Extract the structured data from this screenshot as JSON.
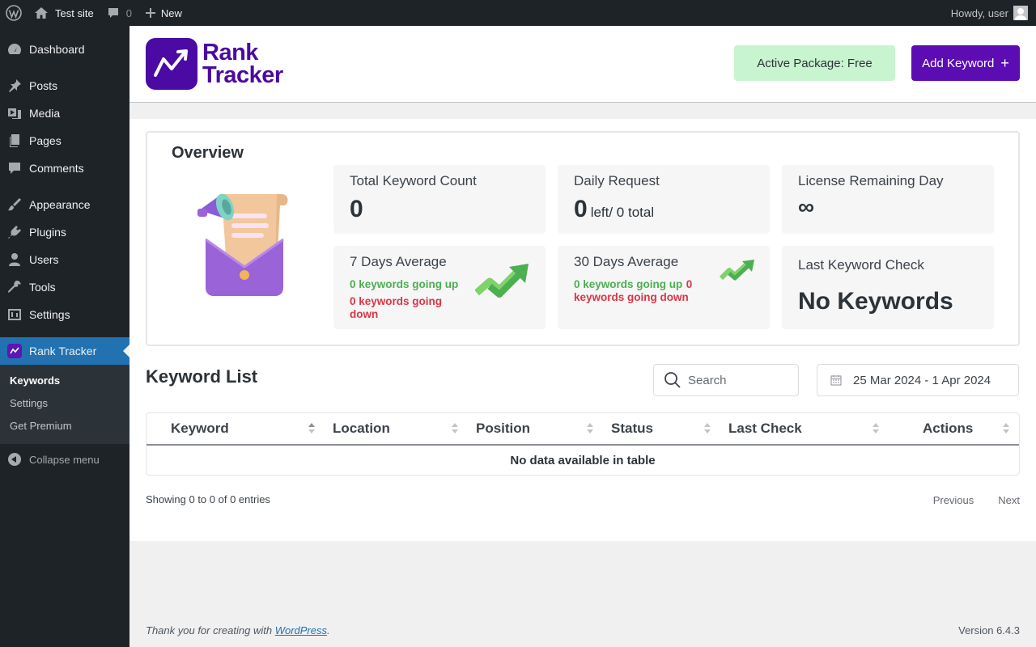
{
  "adminbar": {
    "site_name": "Test site",
    "comments_count": "0",
    "new_label": "New",
    "greeting": "Howdy, user"
  },
  "sidebar": {
    "items": [
      {
        "label": "Dashboard",
        "icon": "dashboard-icon"
      },
      {
        "label": "Posts",
        "icon": "pin-icon"
      },
      {
        "label": "Media",
        "icon": "media-icon"
      },
      {
        "label": "Pages",
        "icon": "pages-icon"
      },
      {
        "label": "Comments",
        "icon": "comment-icon"
      },
      {
        "label": "Appearance",
        "icon": "brush-icon"
      },
      {
        "label": "Plugins",
        "icon": "plug-icon"
      },
      {
        "label": "Users",
        "icon": "user-icon"
      },
      {
        "label": "Tools",
        "icon": "wrench-icon"
      },
      {
        "label": "Settings",
        "icon": "settings-icon"
      },
      {
        "label": "Rank Tracker",
        "icon": "rank-tracker-icon"
      }
    ],
    "submenu": [
      "Keywords",
      "Settings",
      "Get Premium"
    ],
    "collapse_label": "Collapse menu"
  },
  "header": {
    "logo_line1": "Rank",
    "logo_line2": "Tracker",
    "package_label": "Active Package: Free",
    "add_keyword_label": "Add Keyword",
    "add_keyword_icon": "+"
  },
  "overview": {
    "title": "Overview",
    "total_keyword": {
      "label": "Total Keyword Count",
      "value": "0"
    },
    "daily_request": {
      "label": "Daily Request",
      "value": "0",
      "suffix": "left/ 0 total"
    },
    "license": {
      "label": "License Remaining Day",
      "value": "∞"
    },
    "avg7": {
      "label": "7 Days Average",
      "up": "0 keywords going up",
      "down": "0 keywords going down"
    },
    "avg30": {
      "label": "30 Days Average",
      "up": "0 keywords going up",
      "down": "0 keywords going down"
    },
    "last_check": {
      "label": "Last Keyword Check",
      "value": "No Keywords"
    }
  },
  "keyword_list": {
    "title": "Keyword List",
    "search_placeholder": "Search",
    "date_range": "25 Mar 2024 - 1 Apr 2024",
    "columns": [
      "Keyword",
      "Location",
      "Position",
      "Status",
      "Last Check",
      "Actions"
    ],
    "empty_message": "No data available in table",
    "showing": "Showing 0 to 0 of 0 entries",
    "prev_label": "Previous",
    "next_label": "Next"
  },
  "footer": {
    "thanks_prefix": "Thank you for creating with ",
    "thanks_link": "WordPress",
    "thanks_suffix": ".",
    "version": "Version 6.4.3"
  },
  "colors": {
    "brand": "#4a0aa3",
    "admin_dark": "#1d2327",
    "active_blue": "#2271b1",
    "up_green": "#4caf50",
    "down_red": "#dc3545",
    "package_bg": "#c8f4cf"
  }
}
